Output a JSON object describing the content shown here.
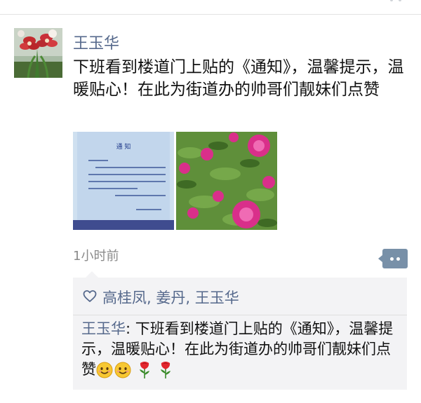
{
  "post": {
    "author": "王玉华",
    "text": "下班看到楼道门上贴的《通知》，温馨提示，温暖贴心！在此为街道办的帅哥们靓妹们点赞",
    "time": "1小时前"
  },
  "photos": [
    {
      "caption": "通 知"
    },
    {
      "caption": ""
    }
  ],
  "likes": {
    "names": "高桂凤, 姜丹, 王玉华"
  },
  "comment": {
    "author": "王玉华",
    "separator": ": ",
    "text": "下班看到楼道门上贴的《通知》，温馨提示，温暖贴心！在此为街道办的帅哥们靓妹们点赞"
  },
  "colors": {
    "link": "#56698c",
    "time": "#8a8a8a",
    "comment_button": "#7890a8",
    "panel": "#f3f3f5"
  },
  "icons": {
    "like": "heart-outline-icon",
    "comment": "comment-bubble-icon",
    "emoji_1": "smiling-face-emoji",
    "emoji_2": "smiling-face-emoji",
    "emoji_3": "rose-emoji",
    "emoji_4": "rose-emoji"
  }
}
